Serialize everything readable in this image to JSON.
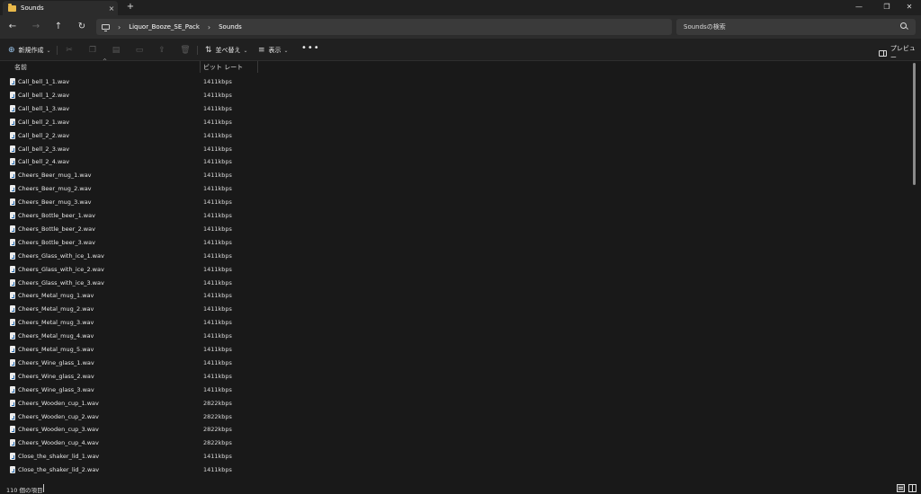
{
  "window": {
    "tab_title": "Sounds",
    "new_tab": "+",
    "close_tab": "×"
  },
  "nav": {
    "breadcrumb": [
      "Liquor_Booze_SE_Pack",
      "Sounds"
    ],
    "search_placeholder": "Soundsの検索"
  },
  "command_bar": {
    "new_label": "新規作成",
    "sort_label": "並べ替え",
    "view_label": "表示",
    "more_label": "•••",
    "preview_label": "プレビュー"
  },
  "columns": {
    "name": "名前",
    "bitrate": "ビット レート"
  },
  "files": [
    {
      "name": "Call_bell_1_1.wav",
      "bitrate": "1411kbps"
    },
    {
      "name": "Call_bell_1_2.wav",
      "bitrate": "1411kbps"
    },
    {
      "name": "Call_bell_1_3.wav",
      "bitrate": "1411kbps"
    },
    {
      "name": "Call_bell_2_1.wav",
      "bitrate": "1411kbps"
    },
    {
      "name": "Call_bell_2_2.wav",
      "bitrate": "1411kbps"
    },
    {
      "name": "Call_bell_2_3.wav",
      "bitrate": "1411kbps"
    },
    {
      "name": "Call_bell_2_4.wav",
      "bitrate": "1411kbps"
    },
    {
      "name": "Cheers_Beer_mug_1.wav",
      "bitrate": "1411kbps"
    },
    {
      "name": "Cheers_Beer_mug_2.wav",
      "bitrate": "1411kbps"
    },
    {
      "name": "Cheers_Beer_mug_3.wav",
      "bitrate": "1411kbps"
    },
    {
      "name": "Cheers_Bottle_beer_1.wav",
      "bitrate": "1411kbps"
    },
    {
      "name": "Cheers_Bottle_beer_2.wav",
      "bitrate": "1411kbps"
    },
    {
      "name": "Cheers_Bottle_beer_3.wav",
      "bitrate": "1411kbps"
    },
    {
      "name": "Cheers_Glass_with_ice_1.wav",
      "bitrate": "1411kbps"
    },
    {
      "name": "Cheers_Glass_with_ice_2.wav",
      "bitrate": "1411kbps"
    },
    {
      "name": "Cheers_Glass_with_ice_3.wav",
      "bitrate": "1411kbps"
    },
    {
      "name": "Cheers_Metal_mug_1.wav",
      "bitrate": "1411kbps"
    },
    {
      "name": "Cheers_Metal_mug_2.wav",
      "bitrate": "1411kbps"
    },
    {
      "name": "Cheers_Metal_mug_3.wav",
      "bitrate": "1411kbps"
    },
    {
      "name": "Cheers_Metal_mug_4.wav",
      "bitrate": "1411kbps"
    },
    {
      "name": "Cheers_Metal_mug_5.wav",
      "bitrate": "1411kbps"
    },
    {
      "name": "Cheers_Wine_glass_1.wav",
      "bitrate": "1411kbps"
    },
    {
      "name": "Cheers_Wine_glass_2.wav",
      "bitrate": "1411kbps"
    },
    {
      "name": "Cheers_Wine_glass_3.wav",
      "bitrate": "1411kbps"
    },
    {
      "name": "Cheers_Wooden_cup_1.wav",
      "bitrate": "2822kbps"
    },
    {
      "name": "Cheers_Wooden_cup_2.wav",
      "bitrate": "2822kbps"
    },
    {
      "name": "Cheers_Wooden_cup_3.wav",
      "bitrate": "2822kbps"
    },
    {
      "name": "Cheers_Wooden_cup_4.wav",
      "bitrate": "2822kbps"
    },
    {
      "name": "Close_the_shaker_lid_1.wav",
      "bitrate": "1411kbps"
    },
    {
      "name": "Close_the_shaker_lid_2.wav",
      "bitrate": "1411kbps"
    }
  ],
  "status": {
    "item_count": "110 個の項目"
  }
}
